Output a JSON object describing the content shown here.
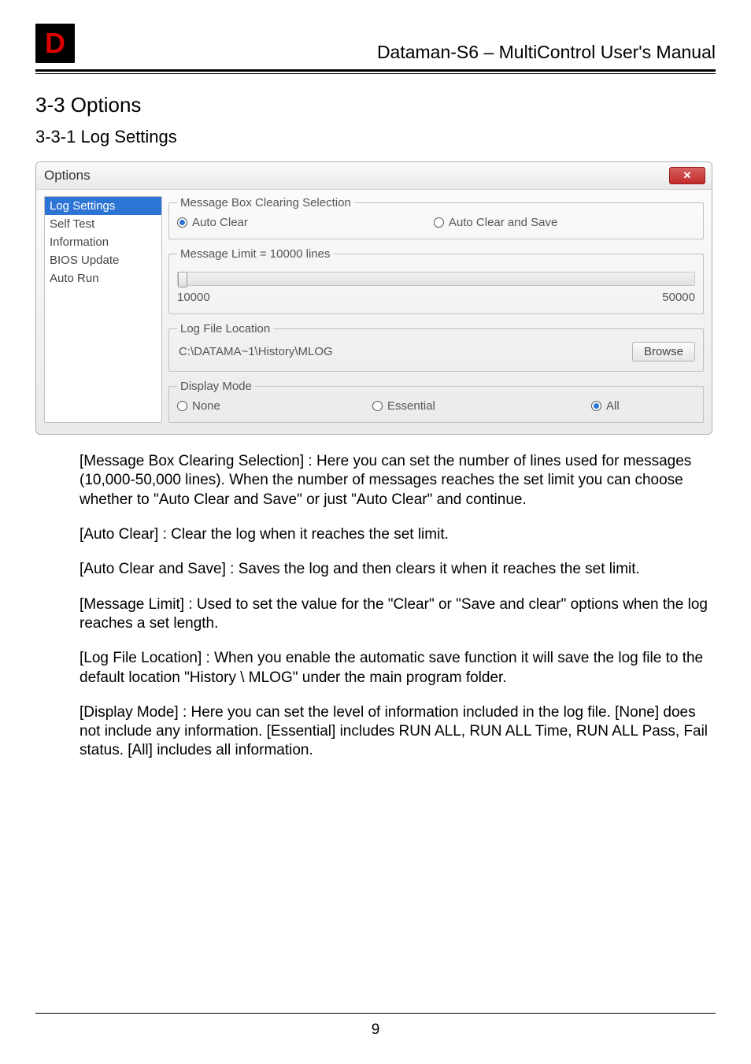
{
  "header": {
    "doc_title": "Dataman-S6 – MultiControl User's Manual"
  },
  "logo_letter": "D",
  "h1": "3-3 Options",
  "h2": "3-3-1 Log Settings",
  "dialog": {
    "title": "Options",
    "close_glyph": "✕",
    "nav": {
      "items": [
        "Log Settings",
        "Self Test",
        "Information",
        "BIOS Update",
        "Auto Run"
      ],
      "selected_index": 0
    },
    "group_msgbox": {
      "legend": "Message Box Clearing Selection",
      "opt1": "Auto Clear",
      "opt2": "Auto Clear and Save",
      "selected": "opt1"
    },
    "group_limit": {
      "legend": "Message Limit = 10000  lines",
      "min_label": "10000",
      "max_label": "50000"
    },
    "group_logfile": {
      "legend": "Log File Location",
      "path": "C:\\DATAMA~1\\History\\MLOG",
      "browse": "Browse"
    },
    "group_display": {
      "legend": "Display Mode",
      "opt_none": "None",
      "opt_essential": "Essential",
      "opt_all": "All",
      "selected": "opt_all"
    }
  },
  "paragraphs": {
    "p1": "[Message Box Clearing Selection] : Here you can set the number of lines used for messages (10,000-50,000 lines). When the number of messages reaches the set limit you can choose whether to \"Auto Clear and Save\" or just \"Auto Clear\" and continue.",
    "p2": "[Auto Clear] : Clear the log when it reaches the set limit.",
    "p3": "[Auto Clear and Save] : Saves the log and then clears it when it reaches the set limit.",
    "p4": "[Message Limit] : Used to set the value for the \"Clear\" or \"Save and clear\" options when the log reaches a set length.",
    "p5": "[Log File Location] : When you enable the automatic save function it will save the log file to the default location \"History \\ MLOG\" under the main program folder.",
    "p6": "[Display Mode] : Here you can set the level of information included in the log file. [None] does not include any information. [Essential] includes RUN ALL, RUN ALL Time, RUN ALL Pass, Fail status. [All] includes all information."
  },
  "page_number": "9"
}
